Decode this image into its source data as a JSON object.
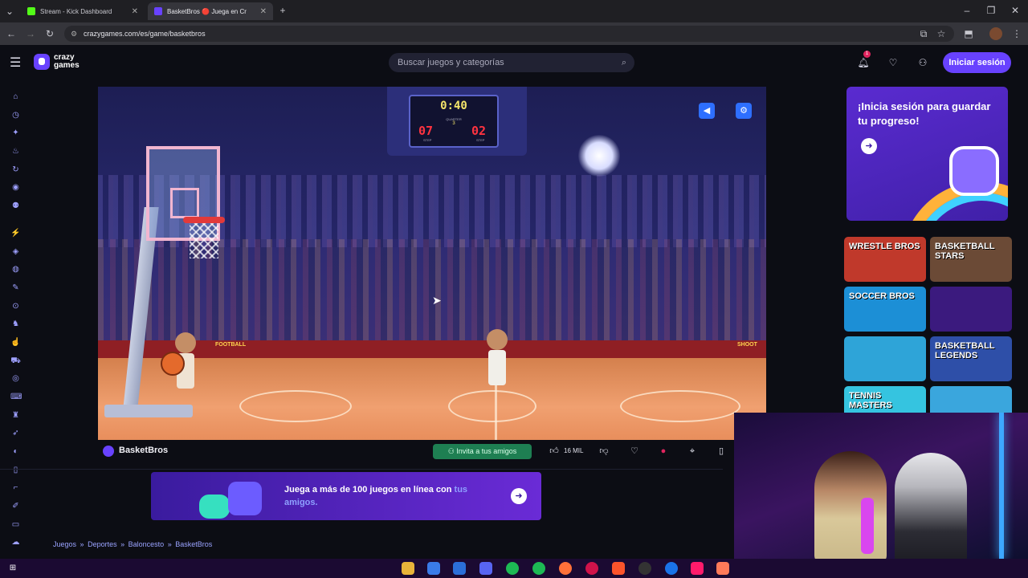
{
  "browser": {
    "tabs": [
      {
        "label": "Stream - Kick Dashboard",
        "active": false
      },
      {
        "label": "BasketBros 🔴 Juega en Cr",
        "active": true
      }
    ],
    "new_tab": "+",
    "url": "crazygames.com/es/game/basketbros"
  },
  "site": {
    "logo_line1": "crazy",
    "logo_line2": "games",
    "search_placeholder": "Buscar juegos y categorías",
    "notification_count": "1",
    "login_label": "Iniciar sesión",
    "accent": "#6842ff"
  },
  "game": {
    "clock": "0:40",
    "quarter_label": "QUARTER",
    "quarter": "3",
    "score_left": "07",
    "score_right": "02",
    "team_left": "STEP",
    "team_right": "STEP",
    "board_left": "FOOTBALL",
    "board_right": "SHOOT",
    "title": "BasketBros",
    "invite_label": "Invita a tus amigos",
    "likes": "16 MIL"
  },
  "promo": {
    "text_main": "Juega a más de 100 juegos en línea con ",
    "text_highlight": "tus amigos."
  },
  "breadcrumb": {
    "items": [
      "Juegos",
      "Deportes",
      "Baloncesto",
      "BasketBros"
    ],
    "separator": "»"
  },
  "sidebar_card": {
    "title": "¡Inicia sesión para guardar tu progreso!"
  },
  "thumbnails": [
    {
      "label": "WRESTLE BROS",
      "color": "#c0392b"
    },
    {
      "label": "BASKETBALL STARS",
      "color": "#6b4a36"
    },
    {
      "label": "SOCCER BROS",
      "color": "#1c8fd6"
    },
    {
      "label": "",
      "color": "#3b1a7e"
    },
    {
      "label": "",
      "color": "#2ea4d8"
    },
    {
      "label": "BASKETBALL LEGENDS",
      "color": "#2e4fa8"
    },
    {
      "label": "TENNIS MASTERS",
      "color": "#35c4e0"
    },
    {
      "label": "",
      "color": "#3aa6dd"
    }
  ]
}
